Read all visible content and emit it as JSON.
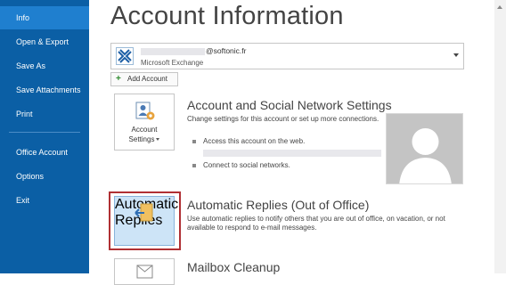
{
  "sidebar": {
    "items": [
      {
        "label": "Info",
        "active": true
      },
      {
        "label": "Open & Export"
      },
      {
        "label": "Save As"
      },
      {
        "label": "Save Attachments"
      },
      {
        "label": "Print"
      },
      {
        "label": "Office Account"
      },
      {
        "label": "Options"
      },
      {
        "label": "Exit"
      }
    ],
    "colors": {
      "background": "#0b5fa5",
      "active": "#1f7fcf"
    }
  },
  "main": {
    "title": "Account Information",
    "account": {
      "email_suffix": "@softonic.fr",
      "type": "Microsoft Exchange",
      "icon": "exchange-icon"
    },
    "add_account_label": "Add Account",
    "sections": {
      "settings": {
        "button_line1": "Account",
        "button_line2": "Settings",
        "title": "Account and Social Network Settings",
        "desc": "Change settings for this account or set up more connections.",
        "bullet1": "Access this account on the web.",
        "bullet2": "Connect to social networks."
      },
      "auto_replies": {
        "button_line1": "Automatic",
        "button_line2": "Replies",
        "title": "Automatic Replies (Out of Office)",
        "desc": "Use automatic replies to notify others that you are out of office, on vacation, or not available to respond to e-mail messages."
      },
      "mailbox": {
        "title": "Mailbox Cleanup"
      }
    },
    "highlight_color": "#b03034"
  }
}
